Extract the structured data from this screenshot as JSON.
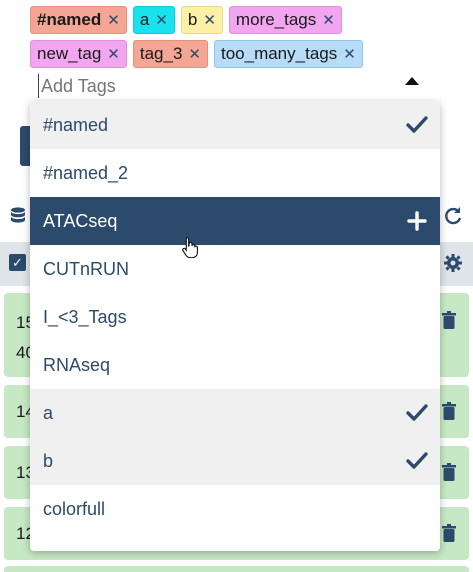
{
  "tags": {
    "row1": [
      {
        "label": "#named",
        "bg": "#f5a593",
        "bold": true
      },
      {
        "label": "a",
        "bg": "#19e2ee",
        "bold": false
      },
      {
        "label": "b",
        "bg": "#fbf0a6",
        "bold": false
      },
      {
        "label": "more_tags",
        "bg": "#f3a6f0",
        "bold": false
      }
    ],
    "row2": [
      {
        "label": "new_tag",
        "bg": "#f3a6f0",
        "bold": false
      },
      {
        "label": "tag_3",
        "bg": "#f5a593",
        "bold": false
      },
      {
        "label": "too_many_tags",
        "bg": "#b6dcf7",
        "bold": false
      }
    ],
    "remove_icon": "close-icon"
  },
  "add_tags_placeholder": "Add Tags",
  "options": [
    {
      "label": "#named",
      "state": "selected",
      "icon": "check-icon"
    },
    {
      "label": "#named_2",
      "state": "normal",
      "icon": ""
    },
    {
      "label": "ATACseq",
      "state": "active",
      "icon": "plus-icon"
    },
    {
      "label": "CUTnRUN",
      "state": "normal",
      "icon": ""
    },
    {
      "label": "I_<3_Tags",
      "state": "normal",
      "icon": ""
    },
    {
      "label": "RNAseq",
      "state": "normal",
      "icon": ""
    },
    {
      "label": "a",
      "state": "selected",
      "icon": "check-icon"
    },
    {
      "label": "b",
      "state": "selected",
      "icon": "check-icon"
    },
    {
      "label": "colorfull",
      "state": "normal",
      "icon": ""
    }
  ],
  "background": {
    "card_prefixes": [
      "15",
      "40",
      "14",
      "13",
      "12"
    ]
  },
  "colors": {
    "accent": "#2c4a6b",
    "selected_bg": "#f0f0f1",
    "card_bg": "#c6e8c4",
    "header_bg": "#dfe4e8"
  }
}
